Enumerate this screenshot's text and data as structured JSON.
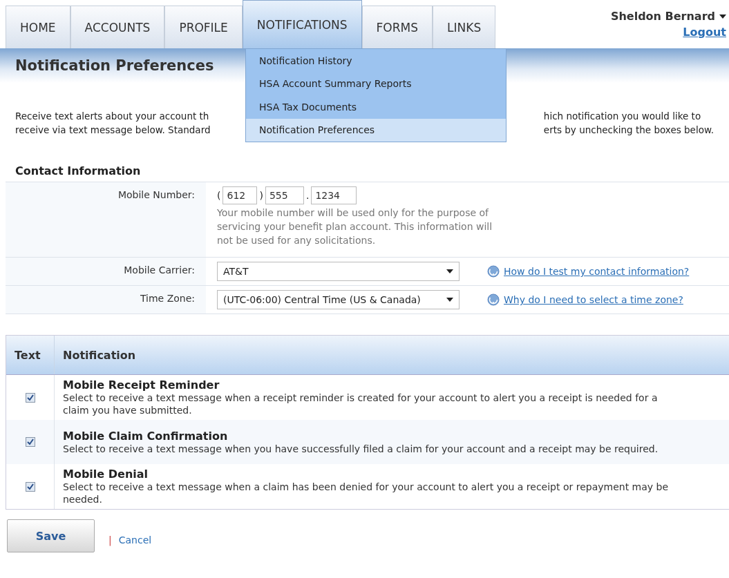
{
  "nav": {
    "tabs": [
      {
        "label": "HOME",
        "selected": false
      },
      {
        "label": "ACCOUNTS",
        "selected": false
      },
      {
        "label": "PROFILE",
        "selected": false
      },
      {
        "label": "NOTIFICATIONS",
        "selected": true
      },
      {
        "label": "FORMS",
        "selected": false
      },
      {
        "label": "LINKS",
        "selected": false
      }
    ],
    "user": "Sheldon Bernard",
    "logout": "Logout"
  },
  "dropdown": {
    "items": [
      {
        "label": "Notification History",
        "selected": false
      },
      {
        "label": "HSA Account Summary Reports",
        "selected": false
      },
      {
        "label": "HSA Tax Documents",
        "selected": false
      },
      {
        "label": "Notification Preferences",
        "selected": true
      }
    ]
  },
  "page_title": "Notification Preferences",
  "intro": {
    "left": [
      "Receive text alerts about your account th",
      "receive via text message below. Standard"
    ],
    "right": [
      "hich notification you would like to",
      "erts by unchecking the boxes below."
    ]
  },
  "contact": {
    "title": "Contact Information",
    "mobile": {
      "label": "Mobile Number:",
      "area": "612",
      "prefix": "555",
      "line": "1234",
      "open_paren": "(",
      "close_paren": ")",
      "dot": ".",
      "note": "Your mobile number will be used only for the purpose of servicing your benefit plan account. This information will not be used for any solicitations."
    },
    "carrier": {
      "label": "Mobile Carrier:",
      "value": "AT&T",
      "help": "How do I test my contact information?"
    },
    "timezone": {
      "label": "Time Zone:",
      "value": "(UTC-06:00) Central Time (US & Canada)",
      "help": "Why do I need to select a time zone?"
    }
  },
  "table": {
    "columns": [
      "Text",
      "Notification"
    ],
    "rows": [
      {
        "checked": true,
        "title": "Mobile Receipt Reminder",
        "description": "Select to receive a text message when a receipt reminder is created for your account to alert you a receipt is needed for a claim you have submitted."
      },
      {
        "checked": true,
        "title": "Mobile Claim Confirmation",
        "description": "Select to receive a text message when you have successfully filed a claim for your account and a receipt may be required."
      },
      {
        "checked": true,
        "title": "Mobile Denial",
        "description": "Select to receive a text message when a claim has been denied for your account to alert you a receipt or repayment may be needed."
      }
    ]
  },
  "actions": {
    "save": "Save",
    "separator": "|",
    "cancel": "Cancel"
  }
}
